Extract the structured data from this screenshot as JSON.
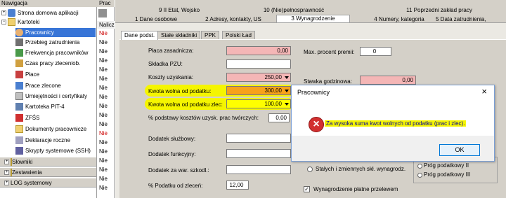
{
  "nav": {
    "header": "Nawigacja",
    "items": [
      {
        "label": "Strona domowa aplikacji"
      },
      {
        "label": "Kartoteki"
      },
      {
        "label": "Pracownicy"
      },
      {
        "label": "Przebieg zatrudnienia"
      },
      {
        "label": "Frekwencja pracowników"
      },
      {
        "label": "Czas pracy zleceniob."
      },
      {
        "label": "Płace"
      },
      {
        "label": "Prace zlecone"
      },
      {
        "label": "Umiejętności i certyfikaty"
      },
      {
        "label": "Kartoteka PIT-4"
      },
      {
        "label": "ZFŚS"
      },
      {
        "label": "Dokumenty pracownicze"
      },
      {
        "label": "Deklaracje roczne"
      },
      {
        "label": "Skrypty systemowe (SSH)"
      }
    ],
    "bars": [
      "Słowniki",
      "Zestawienia",
      "LOG systemowy"
    ]
  },
  "midcol": {
    "header": "Prac",
    "sub": "Naliczenie",
    "values": [
      "Nie",
      "Nie",
      "Nie",
      "Nie",
      "Nie",
      "Nie",
      "Nie",
      "Nie",
      "Nie",
      "Nie",
      "Nie",
      "Nie",
      "Nie",
      "Nie",
      "Nie",
      "Nie",
      "Nie",
      "Nie"
    ]
  },
  "tabs_row1": [
    "9 II Etat, Wojsko",
    "10 (Nie)pełnosprawność",
    "11 Poprzedni zakład pracy"
  ],
  "tabs_row2": [
    "1 Dane osobowe",
    "2 Adresy, kontakty, US",
    "3 Wynagrodzenie",
    "4 Numery, kategoria",
    "5 Data zatrudnienia,"
  ],
  "inner_tabs": [
    "Dane podst.",
    "Stałe składniki",
    "PPK",
    "Polski Ład"
  ],
  "form": {
    "placa_label": "Płaca zasadnicza:",
    "placa_value": "0,00",
    "skladka_label": "Składka PZU:",
    "koszty_label": "Koszty uzyskania:",
    "koszty_value": "250,00",
    "kwota_label": "Kwota wolna od podatku:",
    "kwota_value": "300,00",
    "kwota_zlec_label": "Kwota wolna od podatku zlec:",
    "kwota_zlec_value": "100,00",
    "procent_label": "% podstawy kosztów uzysk. prac twórczych:",
    "procent_value": "0,00",
    "dodatek_sl_label": "Dodatek służbowy:",
    "dodatek_fun_label": "Dodatek funkcyjny:",
    "dodatek_war_label": "Dodatek za war. szkodl.:",
    "podatek_label": "% Podatku od zleceń:",
    "podatek_value": "12,00",
    "max_label": "Max. procent premii:",
    "max_value": "0",
    "stawka_label": "Stawka godzinowa:",
    "stawka_value": "0,00",
    "stalych_label": "Stałych i zmiennych skł. wynagrodz.",
    "prog2": "Próg podatkowy II",
    "prog3": "Próg podatkowy III",
    "wyn_label": "Wynagrodzenie płatne przelewem"
  },
  "dialog": {
    "title": "Pracownicy",
    "message": "Za wysoka suma kwot wolnych od podatku (prac i zlec).",
    "ok": "OK"
  }
}
